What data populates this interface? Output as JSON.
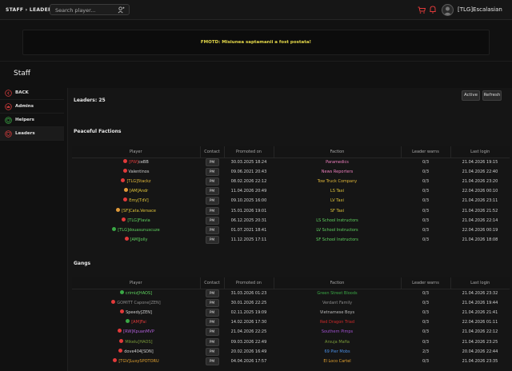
{
  "header": {
    "breadcrumb": "STAFF › LEADERS",
    "search_placeholder": "Search player...",
    "username": "[TLG]Escalasian"
  },
  "motd": "FMOTD: Misiunea saptamanii a fost postata!",
  "page_title": "Staff",
  "sidebar": {
    "items": [
      {
        "label": "BACK",
        "icon": "back-icon",
        "color": "#d23b3b"
      },
      {
        "label": "Admins",
        "icon": "crown-icon",
        "color": "#d23b3b"
      },
      {
        "label": "Helpers",
        "icon": "shield-icon",
        "color": "#3aa845"
      },
      {
        "label": "Leaders",
        "icon": "star-icon",
        "color": "#d23b3b"
      }
    ]
  },
  "main": {
    "leaders_count": "Leaders: 25",
    "buttons": {
      "active": "Active",
      "refresh": "Refresh"
    },
    "columns": [
      "Player",
      "Contact",
      "Promoted on",
      "Faction",
      "Leader warns",
      "Last login"
    ],
    "pm_label": "PM",
    "peaceful": {
      "title": "Peaceful Factions",
      "rows": [
        {
          "status": "#e23a3a",
          "tag": "[PW]",
          "tag_color": "#e23a3a",
          "name": "ceBB",
          "name_color": "#cfcfcf",
          "promoted": "30.03.2025 18:24",
          "faction": "Paramedics",
          "faction_color": "#ee7fbf",
          "warns": "0/3",
          "login": "21.04.2026 19:15"
        },
        {
          "status": "#e23a3a",
          "tag": "",
          "tag_color": "#cfcfcf",
          "name": "Valentinos",
          "name_color": "#cfcfcf",
          "promoted": "09.06.2021 20:43",
          "faction": "News Reporters",
          "faction_color": "#ee7fbf",
          "warns": "0/3",
          "login": "21.04.2026 22:40"
        },
        {
          "status": "#e23a3a",
          "tag": "[TLG]",
          "tag_color": "#e0b73a",
          "name": "5tackz",
          "name_color": "#e0b73a",
          "promoted": "08.02.2026 22:12",
          "faction": "Tow Truck Company",
          "faction_color": "#e0b73a",
          "warns": "0/3",
          "login": "21.04.2026 23:20"
        },
        {
          "status": "#e09a3a",
          "tag": "[AM]",
          "tag_color": "#e0c43a",
          "name": "Andr",
          "name_color": "#e0c43a",
          "promoted": "11.04.2026 20:49",
          "faction": "LS Taxi",
          "faction_color": "#e0c43a",
          "warns": "0/3",
          "login": "22.04.2026 00:10"
        },
        {
          "status": "#e23a3a",
          "tag": "",
          "tag_color": "#e0c43a",
          "name": "Emy[TdV]",
          "name_color": "#e0c43a",
          "promoted": "09.10.2025 16:00",
          "faction": "LV Taxi",
          "faction_color": "#e0c43a",
          "warns": "0/3",
          "login": "21.04.2026 23:11"
        },
        {
          "status": "#e09a3a",
          "tag": "[SF]",
          "tag_color": "#e0c43a",
          "name": "Cata.Versace",
          "name_color": "#e0c43a",
          "promoted": "15.01.2026 19:01",
          "faction": "SF Taxi",
          "faction_color": "#e0c43a",
          "warns": "0/3",
          "login": "21.04.2026 21:52"
        },
        {
          "status": "#e23a3a",
          "tag": "[TLG]",
          "tag_color": "#5fd35f",
          "name": "Flavia",
          "name_color": "#5fd35f",
          "promoted": "06.12.2025 20:31",
          "faction": "LS School Instructors",
          "faction_color": "#5fd35f",
          "warns": "0/3",
          "login": "21.04.2026 22:14"
        },
        {
          "status": "#3aa845",
          "tag": "[TLG]",
          "tag_color": "#5fd35f",
          "name": "douasunuscuze",
          "name_color": "#5fd35f",
          "promoted": "01.07.2021 18:41",
          "faction": "LV School Instructors",
          "faction_color": "#5fd35f",
          "warns": "0/3",
          "login": "22.04.2026 00:19"
        },
        {
          "status": "#e23a3a",
          "tag": "[AM]",
          "tag_color": "#5fd35f",
          "name": "Jolly",
          "name_color": "#5fd35f",
          "promoted": "11.12.2025 17:11",
          "faction": "SF School Instructors",
          "faction_color": "#5fd35f",
          "warns": "0/3",
          "login": "21.04.2026 18:08"
        }
      ]
    },
    "gangs": {
      "title": "Gangs",
      "rows": [
        {
          "status": "#3aa845",
          "tag": "",
          "tag_color": "#5fd35f",
          "name": "crimiz[HAOS]",
          "name_color": "#5fd35f",
          "promoted": "31.03.2026 01:23",
          "faction": "Green Street Bloods",
          "faction_color": "#3aa845",
          "warns": "0/3",
          "login": "21.04.2026 23:32"
        },
        {
          "status": "#e23a3a",
          "tag": "",
          "tag_color": "#8a8a8a",
          "name": "GOMITT Capone[ZEN]",
          "name_color": "#8a8a8a",
          "promoted": "30.01.2026 22:25",
          "faction": "Verdant Family",
          "faction_color": "#8a8a8a",
          "warns": "0/3",
          "login": "21.04.2026 19:44"
        },
        {
          "status": "#e23a3a",
          "tag": "",
          "tag_color": "#cfcfcf",
          "name": "Speedy[ZEN]",
          "name_color": "#cfcfcf",
          "promoted": "02.11.2025 19:09",
          "faction": "Vietnamese Boys",
          "faction_color": "#bbbbbb",
          "warns": "0/3",
          "login": "21.04.2026 21:41"
        },
        {
          "status": "#3aa845",
          "tag": "[AM]",
          "tag_color": "#e23a3a",
          "name": "Fai",
          "name_color": "#e23a3a",
          "promoted": "14.02.2026 17:30",
          "faction": "Red Dragon Triad",
          "faction_color": "#cc2a2a",
          "warns": "0/3",
          "login": "22.04.2026 01:11"
        },
        {
          "status": "#e23a3a",
          "tag": "[RW]",
          "tag_color": "#b05fd8",
          "name": "KpuanMVP",
          "name_color": "#b05fd8",
          "promoted": "21.04.2026 22:25",
          "faction": "Southern Pimps",
          "faction_color": "#a050d0",
          "warns": "0/3",
          "login": "21.04.2026 22:12"
        },
        {
          "status": "#e23a3a",
          "tag": "",
          "tag_color": "#7a9a3a",
          "name": "Mikelu[HAOS]",
          "name_color": "#7a9a3a",
          "promoted": "09.03.2026 22:49",
          "faction": "Arsuja Mafia",
          "faction_color": "#7a9a3a",
          "warns": "0/3",
          "login": "21.04.2026 23:25"
        },
        {
          "status": "#e23a3a",
          "tag": "",
          "tag_color": "#cfcfcf",
          "name": "dove404[SDN]",
          "name_color": "#cfcfcf",
          "promoted": "20.02.2026 16:49",
          "faction": "69 Pier Mobs",
          "faction_color": "#4a8de0",
          "warns": "2/3",
          "login": "20.04.2026 22:44"
        },
        {
          "status": "#e23a3a",
          "tag": "[TGV]",
          "tag_color": "#e0a030",
          "name": "LuxySPOTORU",
          "name_color": "#e0a030",
          "promoted": "04.04.2026 17:57",
          "faction": "El Loco Cartel",
          "faction_color": "#e0a030",
          "warns": "0/3",
          "login": "21.04.2026 23:35"
        }
      ]
    }
  }
}
